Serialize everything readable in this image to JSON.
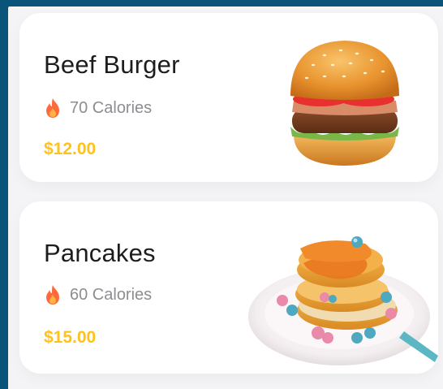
{
  "items": [
    {
      "name": "Beef Burger",
      "calories": "70 Calories",
      "price": "$12.00",
      "image_icon": "burger-image"
    },
    {
      "name": "Pancakes",
      "calories": "60 Calories",
      "price": "$15.00",
      "image_icon": "pancakes-image"
    }
  ],
  "colors": {
    "frame": "#0b5479",
    "price": "#ffc21c",
    "flame": "#ff6a3d",
    "muted_text": "#8d8d92"
  }
}
